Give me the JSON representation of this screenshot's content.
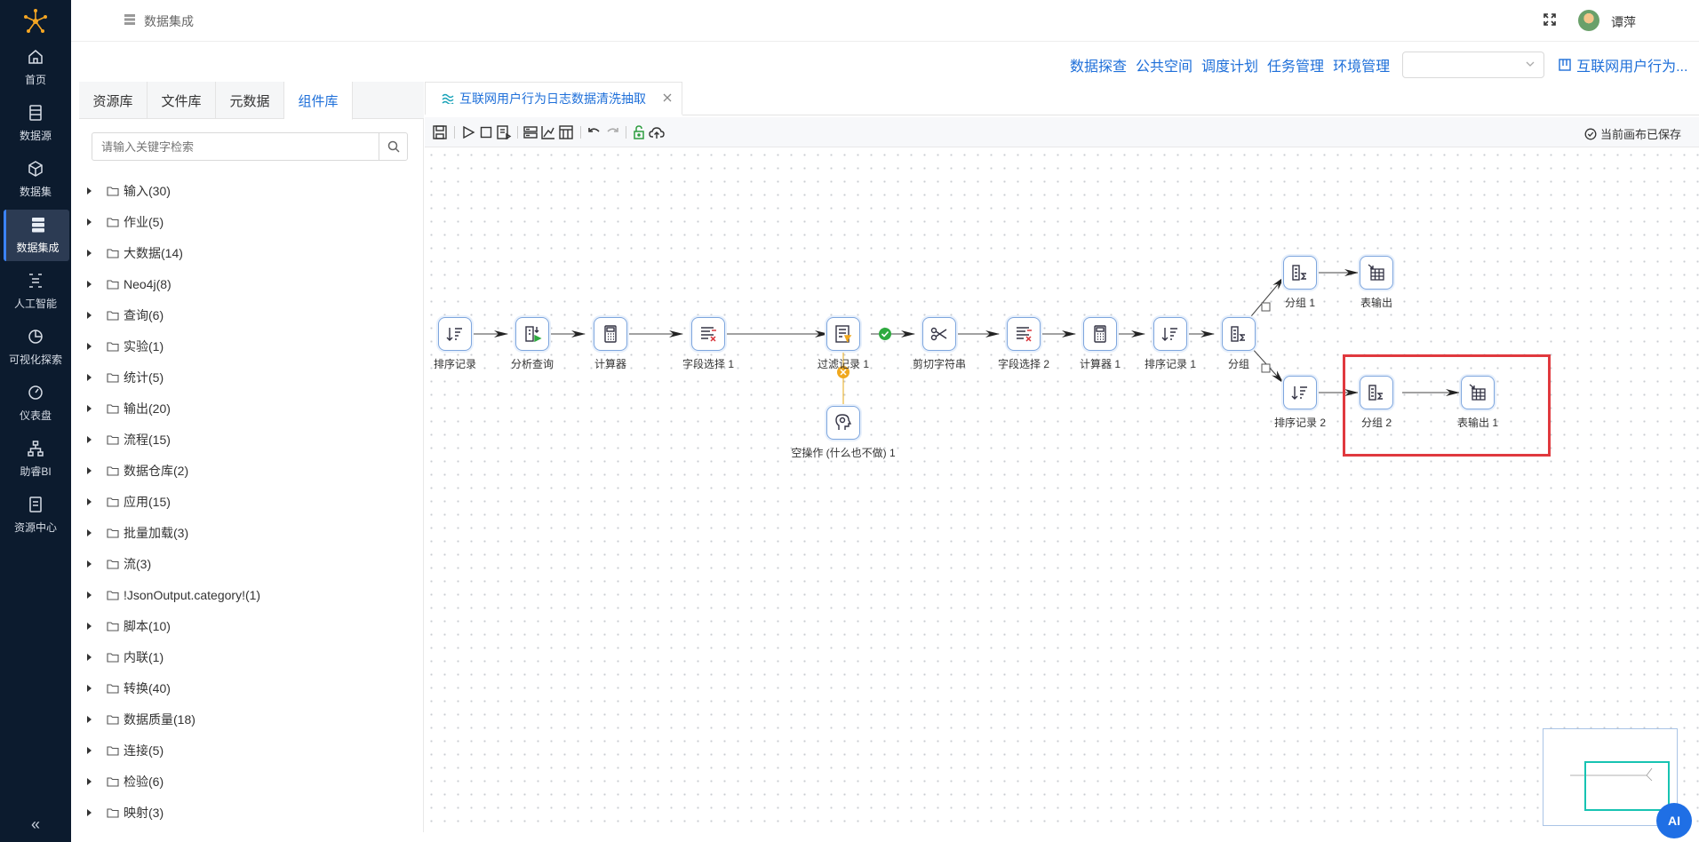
{
  "nav": {
    "items": [
      {
        "label": "首页",
        "icon": "home-icon"
      },
      {
        "label": "数据源",
        "icon": "database-icon"
      },
      {
        "label": "数据集",
        "icon": "cube-icon"
      },
      {
        "label": "数据集成",
        "icon": "server-icon",
        "active": true
      },
      {
        "label": "人工智能",
        "icon": "ai-icon"
      },
      {
        "label": "可视化探索",
        "icon": "pie-chart-icon"
      },
      {
        "label": "仪表盘",
        "icon": "gauge-icon"
      },
      {
        "label": "助睿BI",
        "icon": "hierarchy-icon"
      },
      {
        "label": "资源中心",
        "icon": "document-icon"
      }
    ],
    "collapse_label": "«"
  },
  "header": {
    "title": "数据集成",
    "user_name": "谭萍"
  },
  "actions": {
    "links": [
      "数据探查",
      "公共空间",
      "调度计划",
      "任务管理",
      "环境管理"
    ],
    "env_select_value": "",
    "project_link": "互联网用户行为..."
  },
  "left_panel": {
    "tabs": [
      "资源库",
      "文件库",
      "元数据",
      "组件库"
    ],
    "active_tab": 3,
    "search_placeholder": "请输入关键字检索",
    "tree": [
      "输入(30)",
      "作业(5)",
      "大数据(14)",
      "Neo4j(8)",
      "查询(6)",
      "实验(1)",
      "统计(5)",
      "输出(20)",
      "流程(15)",
      "数据仓库(2)",
      "应用(15)",
      "批量加载(3)",
      "流(3)",
      "!JsonOutput.category!(1)",
      "脚本(10)",
      "内联(1)",
      "转换(40)",
      "数据质量(18)",
      "连接(5)",
      "检验(6)",
      "映射(3)"
    ]
  },
  "canvas": {
    "tab_title": "互联网用户行为日志数据清洗抽取",
    "saved_status": "当前画布已保存",
    "nodes": [
      {
        "id": "n1",
        "label": "排序记录",
        "icon": "sort-icon"
      },
      {
        "id": "n2",
        "label": "分析查询",
        "icon": "analytic-query-icon"
      },
      {
        "id": "n3",
        "label": "计算器",
        "icon": "calculator-icon"
      },
      {
        "id": "n4",
        "label": "字段选择 1",
        "icon": "field-select-icon"
      },
      {
        "id": "n5",
        "label": "过滤记录 1",
        "icon": "filter-icon"
      },
      {
        "id": "n6",
        "label": "剪切字符串",
        "icon": "scissors-icon"
      },
      {
        "id": "n7",
        "label": "字段选择 2",
        "icon": "field-select-icon"
      },
      {
        "id": "n8",
        "label": "计算器 1",
        "icon": "calculator-icon"
      },
      {
        "id": "n9",
        "label": "排序记录 1",
        "icon": "sort-icon"
      },
      {
        "id": "n10",
        "label": "分组",
        "icon": "group-by-icon"
      },
      {
        "id": "n11",
        "label": "分组 1",
        "icon": "group-by-icon"
      },
      {
        "id": "n12",
        "label": "表输出",
        "icon": "table-output-icon"
      },
      {
        "id": "n13",
        "label": "排序记录 2",
        "icon": "sort-icon"
      },
      {
        "id": "n14",
        "label": "分组 2",
        "icon": "group-by-icon"
      },
      {
        "id": "n15",
        "label": "表输出 1",
        "icon": "table-output-icon"
      },
      {
        "id": "n16",
        "label": "空操作 (什么也不做) 1",
        "icon": "dummy-icon"
      }
    ],
    "ai_label": "AI"
  }
}
